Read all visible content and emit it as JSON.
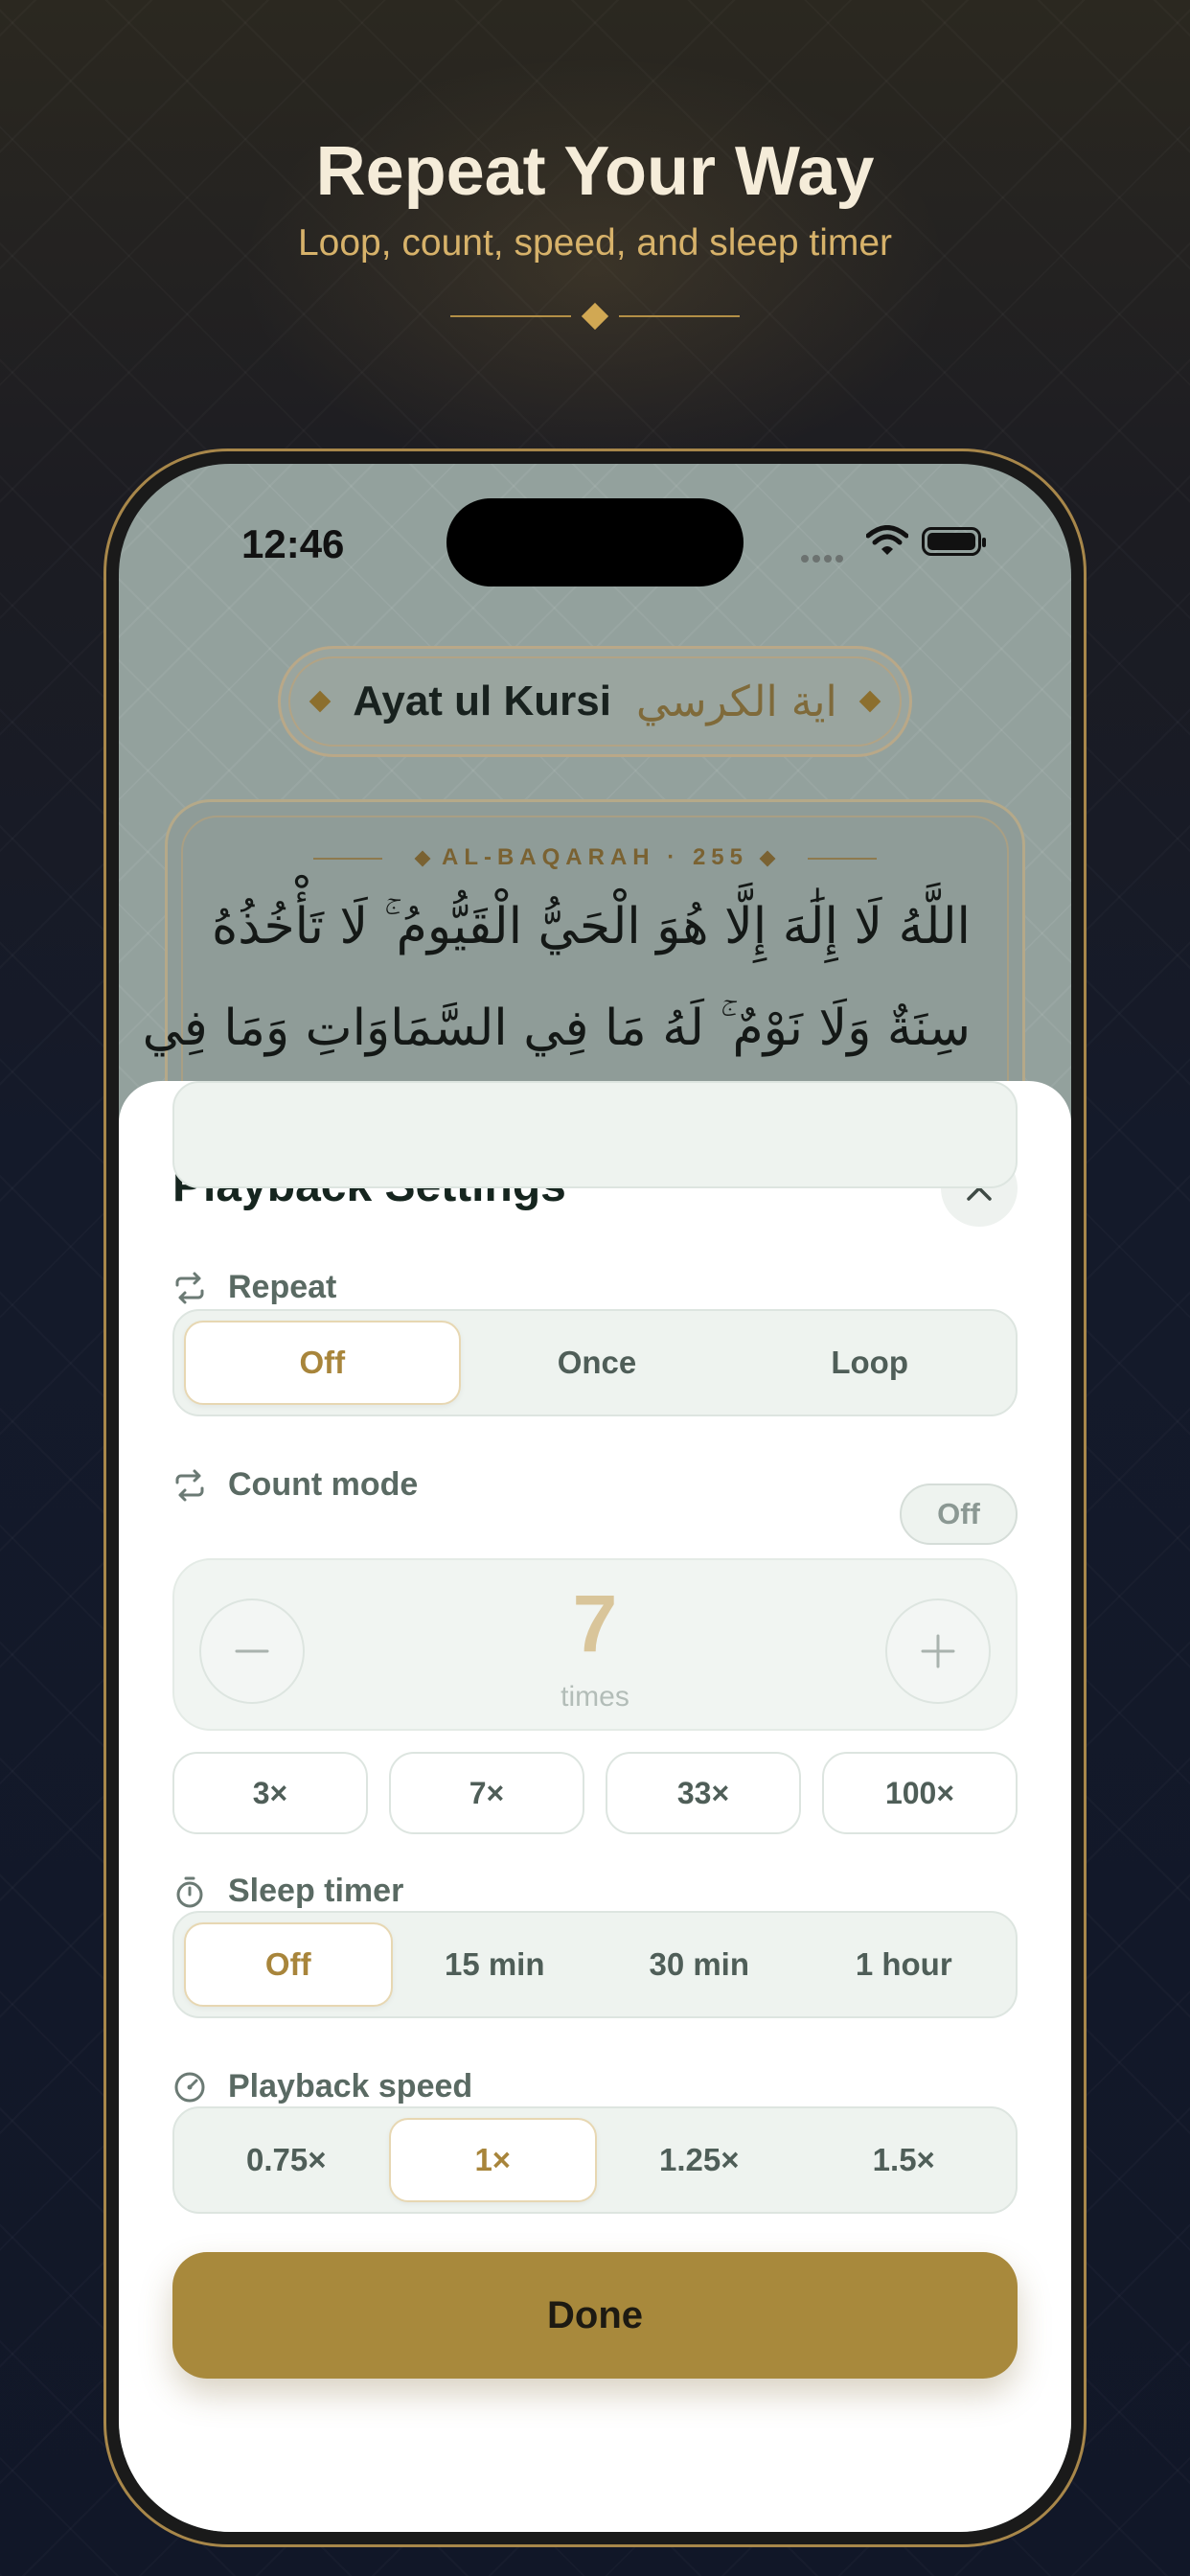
{
  "promo": {
    "headline": "Repeat Your Way",
    "subheadline": "Loop, count, speed, and sleep timer"
  },
  "status_bar": {
    "time": "12:46"
  },
  "reader": {
    "title_en": "Ayat ul Kursi",
    "title_ar": "اية الكرسي",
    "surah_ref": "AL-BAQARAH · 255",
    "arabic_line_1": "اللَّهُ لَا إِلَٰهَ إِلَّا هُوَ الْحَيُّ الْقَيُّومُ ۚ لَا تَأْخُذُهُ",
    "arabic_line_2": "سِنَةٌ وَلَا نَوْمٌ ۚ لَهُ مَا فِي السَّمَاوَاتِ وَمَا فِي"
  },
  "sheet": {
    "title": "Playback Settings",
    "repeat": {
      "label": "Repeat",
      "options": [
        "Off",
        "Once",
        "Loop"
      ],
      "selected": "Off"
    },
    "count_mode": {
      "label": "Count mode",
      "toggle_label": "Off",
      "count": "7",
      "unit": "times",
      "presets": [
        "3×",
        "7×",
        "33×",
        "100×"
      ]
    },
    "sleep_timer": {
      "label": "Sleep timer",
      "options": [
        "Off",
        "15 min",
        "30 min",
        "1 hour"
      ],
      "selected": "Off"
    },
    "playback_speed": {
      "label": "Playback speed",
      "options": [
        "0.75×",
        "1×",
        "1.25×",
        "1.5×"
      ],
      "selected": "1×"
    },
    "done_label": "Done"
  },
  "colors": {
    "accent_gold": "#a8893c",
    "selected_text": "#a8853b",
    "sheet_bg": "#ffffff",
    "segment_bg": "#eef3ef"
  }
}
